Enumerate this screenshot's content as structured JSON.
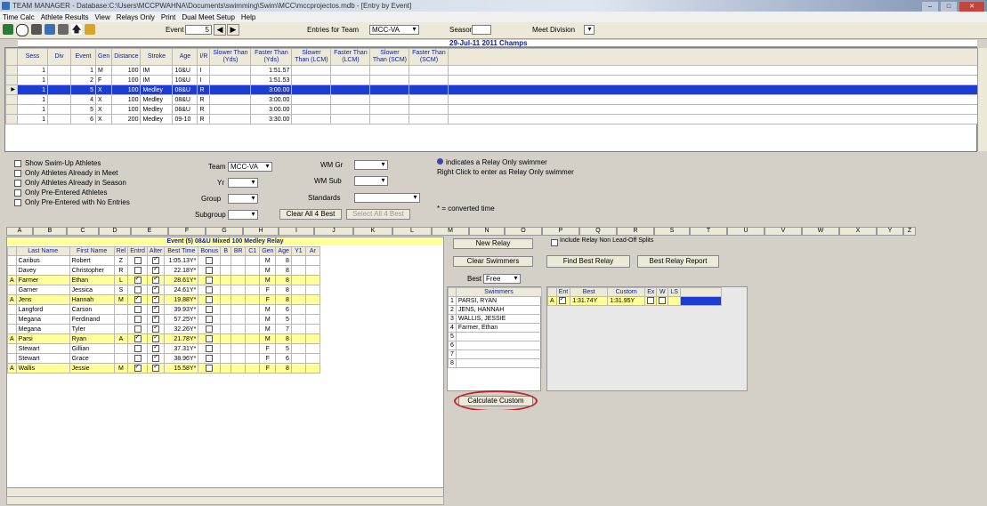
{
  "window": {
    "title": "TEAM MANAGER - Database:C:\\Users\\MCCPWAHNA\\Documents\\swimming\\Swim\\MCC\\mccprojectos.mdb - [Entry by Event]"
  },
  "menu": [
    "Time Calc",
    "Athlete Results",
    "View",
    "Relays Only",
    "Print",
    "Dual Meet Setup",
    "Help"
  ],
  "toolbar": {
    "event_label": "Event",
    "event_value": "5",
    "entries_for_team_label": "Entries for Team",
    "team_value": "MCC-VA",
    "season_label": "Season",
    "meet_division_label": "Meet Division"
  },
  "meet": {
    "date_name": "29-Jul-11  2011 Champs"
  },
  "event_grid": {
    "headers": [
      "Sess",
      "Div",
      "Event",
      "Gen",
      "Distance",
      "Stroke",
      "Age",
      "I/R",
      "Slower Than (Yds)",
      "Faster Than (Yds)",
      "Slower Than (LCM)",
      "Faster Than (LCM)",
      "Slower Than (SCM)",
      "Faster Than (SCM)"
    ],
    "rows": [
      [
        "1",
        "",
        "1",
        "M",
        "100",
        "IM",
        "10&U",
        "I",
        "",
        "1:51.57",
        "",
        "",
        "",
        ""
      ],
      [
        "1",
        "",
        "2",
        "F",
        "100",
        "IM",
        "10&U",
        "I",
        "",
        "1:51.53",
        "",
        "",
        "",
        ""
      ],
      [
        "1",
        "",
        "5",
        "X",
        "100",
        "Medley",
        "08&U",
        "R",
        "",
        "3:00.00",
        "",
        "",
        "",
        ""
      ],
      [
        "1",
        "",
        "4",
        "X",
        "100",
        "Medley",
        "08&U",
        "R",
        "",
        "3:00.00",
        "",
        "",
        "",
        ""
      ],
      [
        "1",
        "",
        "5",
        "X",
        "100",
        "Medley",
        "08&U",
        "R",
        "",
        "3:00.00",
        "",
        "",
        "",
        ""
      ],
      [
        "1",
        "",
        "6",
        "X",
        "200",
        "Medley",
        "09-10",
        "R",
        "",
        "3:30.00",
        "",
        "",
        "",
        ""
      ]
    ],
    "selected_row": 2
  },
  "filters": {
    "checkboxes": [
      "Show Swim-Up Athletes",
      "Only Athletes Already in Meet",
      "Only Athletes Already in Season",
      "Only Pre-Entered Athletes",
      "Only Pre-Entered with No Entries"
    ],
    "team_label": "Team",
    "team_value": "MCC-VA",
    "yr_label": "Yr",
    "group_label": "Group",
    "subgroup_label": "Subgroup",
    "wm_grp_label": "WM Gr",
    "wm_sub_label": "WM Sub",
    "standards_label": "Standards",
    "clear_all_btn": "Clear All 4 Best",
    "select_all_btn": "Select All 4 Best",
    "relay_note_1": "indicates a Relay Only swimmer",
    "relay_note_2": "Right Click to enter as Relay Only swimmer",
    "converted_note": "* = converted time"
  },
  "col_letters": [
    "A",
    "B",
    "C",
    "D",
    "E",
    "F",
    "G",
    "H",
    "I",
    "J",
    "K",
    "L",
    "M",
    "N",
    "O",
    "P",
    "Q",
    "R",
    "S",
    "T",
    "U",
    "V",
    "W",
    "X",
    "Y",
    "Z"
  ],
  "event_caption": "Event (5) 08&U Mixed  100 Medley Relay",
  "athletes": {
    "headers": [
      "",
      "Last Name",
      "First Name",
      "Rel",
      "Entrd",
      "Alter",
      "Best Time",
      "Bonus",
      "B",
      "BR",
      "C1",
      "Gen",
      "Age",
      "Y1",
      "Ar"
    ],
    "rows": [
      {
        "mark": "",
        "last": "Caribus",
        "first": "Robert",
        "rel": "Z",
        "entrd": false,
        "alter": true,
        "time": "1:05.13Y*",
        "gen": "M",
        "age": "8",
        "hl": false
      },
      {
        "mark": "",
        "last": "Davey",
        "first": "Christopher",
        "rel": "R",
        "entrd": false,
        "alter": true,
        "time": "22.18Y*",
        "gen": "M",
        "age": "8",
        "hl": false
      },
      {
        "mark": "A",
        "last": "Farmer",
        "first": "Ethan",
        "rel": "L",
        "entrd": true,
        "alter": true,
        "time": "28.61Y*",
        "gen": "M",
        "age": "8",
        "hl": true
      },
      {
        "mark": "",
        "last": "Garner",
        "first": "Jessica",
        "rel": "S",
        "entrd": false,
        "alter": true,
        "time": "24.61Y*",
        "gen": "F",
        "age": "8",
        "hl": false
      },
      {
        "mark": "A",
        "last": "Jens",
        "first": "Hannah",
        "rel": "M",
        "entrd": true,
        "alter": true,
        "time": "19.88Y*",
        "gen": "F",
        "age": "8",
        "hl": true
      },
      {
        "mark": "",
        "last": "Langford",
        "first": "Carson",
        "rel": "",
        "entrd": false,
        "alter": true,
        "time": "39.93Y*",
        "gen": "M",
        "age": "6",
        "hl": false
      },
      {
        "mark": "",
        "last": "Megana",
        "first": "Ferdinand",
        "rel": "",
        "entrd": false,
        "alter": true,
        "time": "57.25Y*",
        "gen": "M",
        "age": "5",
        "hl": false
      },
      {
        "mark": "",
        "last": "Megana",
        "first": "Tyler",
        "rel": "",
        "entrd": false,
        "alter": true,
        "time": "32.26Y*",
        "gen": "M",
        "age": "7",
        "hl": false
      },
      {
        "mark": "A",
        "last": "Parsi",
        "first": "Ryan",
        "rel": "A",
        "entrd": true,
        "alter": true,
        "time": "21.78Y*",
        "gen": "M",
        "age": "8",
        "hl": true
      },
      {
        "mark": "",
        "last": "Stewart",
        "first": "Gillian",
        "rel": "",
        "entrd": false,
        "alter": true,
        "time": "37.31Y*",
        "gen": "F",
        "age": "5",
        "hl": false
      },
      {
        "mark": "",
        "last": "Stewart",
        "first": "Grace",
        "rel": "",
        "entrd": false,
        "alter": true,
        "time": "38.96Y*",
        "gen": "F",
        "age": "6",
        "hl": false
      },
      {
        "mark": "A",
        "last": "Wallis",
        "first": "Jessie",
        "rel": "M",
        "entrd": true,
        "alter": true,
        "time": "15.58Y*",
        "gen": "F",
        "age": "8",
        "hl": true
      }
    ]
  },
  "relay_builder": {
    "new_relay": "New Relay",
    "clear_swimmers": "Clear Swimmers",
    "best_label": "Best",
    "best_value": "Free",
    "swimmers_header": "Swimmers",
    "swimmers": [
      "PARSI, RYAN",
      "JENS, HANNAH",
      "WALLIS, JESSIE",
      "Farmer, Ethan",
      "",
      "",
      "",
      ""
    ],
    "calculate_custom": "Calculate Custom",
    "include_relay_label": "Include Relay Non Lead-Off Splits",
    "find_best": "Find Best Relay",
    "best_report": "Best Relay Report",
    "result_headers": [
      "",
      "Ent",
      "Best",
      "Custom",
      "Ex",
      "W",
      "LS"
    ],
    "result_row": [
      "A",
      "",
      "1:31.74Y",
      "1:31.95Y",
      "",
      "",
      ""
    ]
  },
  "colors": {
    "selected_row": "#1c3cd6",
    "highlight_row": "#ffff99",
    "header_text": "#1020a0",
    "callout": "#c0262c"
  }
}
